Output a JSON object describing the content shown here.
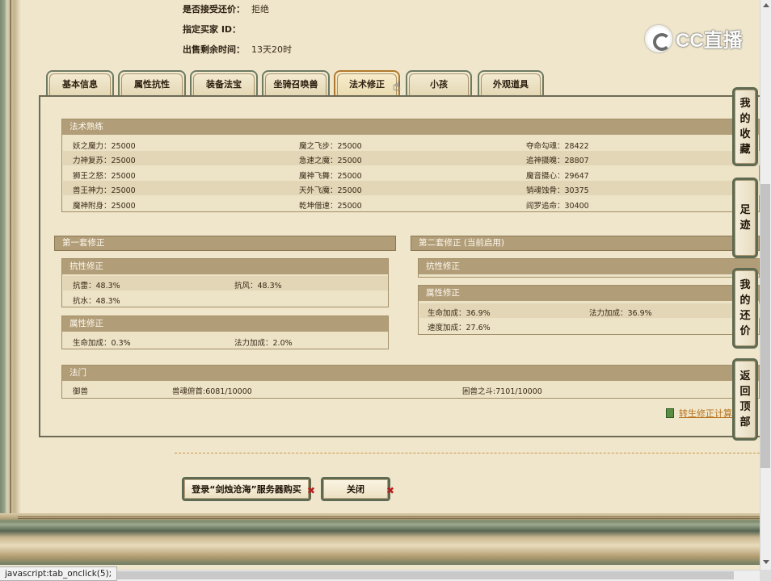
{
  "info": {
    "accept_counter_label": "是否接受还价：",
    "accept_counter_value": "拒绝",
    "buyer_id_label": "指定买家 ID：",
    "buyer_id_value": "",
    "remaining_label": "出售剩余时间：",
    "remaining_value": "13天20时"
  },
  "logo": {
    "text": "CC直播"
  },
  "tabs": [
    {
      "label": "基本信息"
    },
    {
      "label": "属性抗性"
    },
    {
      "label": "装备法宝"
    },
    {
      "label": "坐骑召唤兽"
    },
    {
      "label": "法术修正",
      "active": true
    },
    {
      "label": "小孩"
    },
    {
      "label": "外观道具"
    }
  ],
  "skill_section": {
    "title": "法术熟练",
    "rows": [
      [
        "妖之魔力：25000",
        "魔之飞步：25000",
        "夺命勾魂：28422"
      ],
      [
        "力神复苏：25000",
        "急速之魔：25000",
        "追神摄魄：28807"
      ],
      [
        "狮王之怒：25000",
        "魔神飞舞：25000",
        "魔音摄心：29647"
      ],
      [
        "兽王神力：25000",
        "天外飞魔：25000",
        "销魂蚀骨：30375"
      ],
      [
        "魔神附身：25000",
        "乾坤借速：25000",
        "阎罗追命：30400"
      ]
    ]
  },
  "set1": {
    "title": "第一套修正",
    "resist": {
      "title": "抗性修正",
      "rows": [
        [
          "抗雷：48.3%",
          "抗风：48.3%"
        ],
        [
          "抗水：48.3%",
          ""
        ]
      ]
    },
    "attr": {
      "title": "属性修正",
      "rows": [
        [
          "生命加成：0.3%",
          "法力加成：2.0%"
        ]
      ]
    }
  },
  "set2": {
    "title": "第二套修正 (当前启用)",
    "resist": {
      "title": "抗性修正"
    },
    "attr": {
      "title": "属性修正",
      "rows": [
        [
          "生命加成：36.9%",
          "法力加成：36.9%"
        ],
        [
          "速度加成：27.6%",
          ""
        ]
      ]
    }
  },
  "fa_men": {
    "title": "法门",
    "row": [
      "御兽",
      "兽魂俯首:6081/10000",
      "困兽之斗:7101/10000"
    ]
  },
  "calc_link": "转生修正计算",
  "buttons": {
    "login_buy": "登录“剑烛沧海”服务器购买",
    "close": "关闭"
  },
  "side_nav": [
    {
      "label": [
        "我",
        "的",
        "收",
        "藏"
      ]
    },
    {
      "label": [
        "足",
        "迹"
      ]
    },
    {
      "label": [
        "我",
        "的",
        "还",
        "价"
      ]
    },
    {
      "label": [
        "返",
        "回",
        "顶",
        "部"
      ]
    }
  ],
  "status_bar": "javascript:tab_onclick(5);"
}
